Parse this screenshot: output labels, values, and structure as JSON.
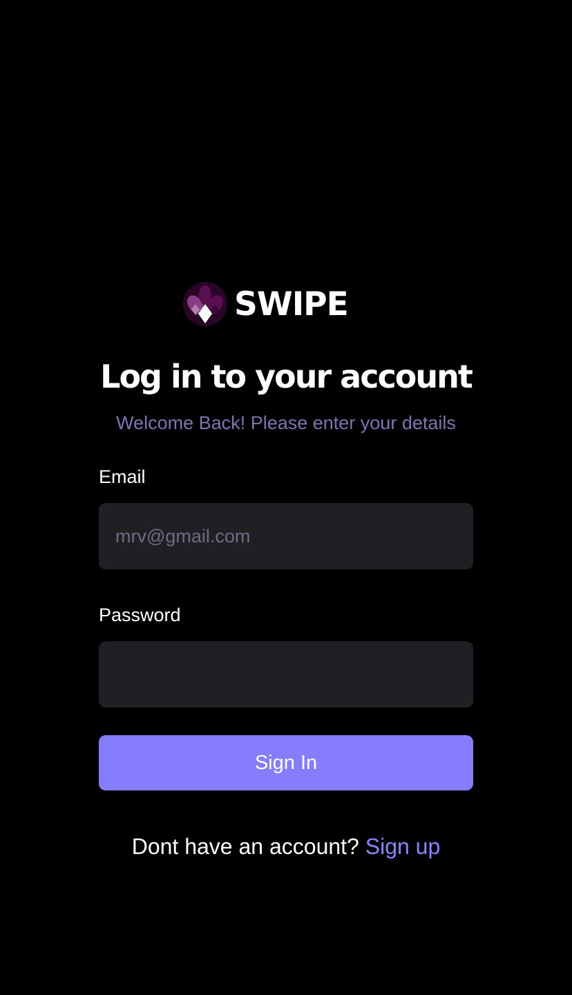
{
  "brand": {
    "name": "SWIPE",
    "logo_icon": "swipe-logo-icon",
    "logo_colors": [
      "#5a0f52",
      "#8a3d87",
      "#ffffff"
    ]
  },
  "header": {
    "title": "Log in to your account",
    "subtitle": "Welcome Back! Please enter your details"
  },
  "form": {
    "email": {
      "label": "Email",
      "value": "",
      "placeholder": "mrv@gmail.com"
    },
    "password": {
      "label": "Password",
      "value": "",
      "placeholder": ""
    },
    "submit_label": "Sign In"
  },
  "footer": {
    "prompt": "Dont have an account?",
    "link_label": "Sign up"
  },
  "colors": {
    "background": "#000000",
    "accent": "#857dfb",
    "link": "#8b84ff",
    "subtitle": "#7b76b3",
    "input_bg": "#202024"
  }
}
